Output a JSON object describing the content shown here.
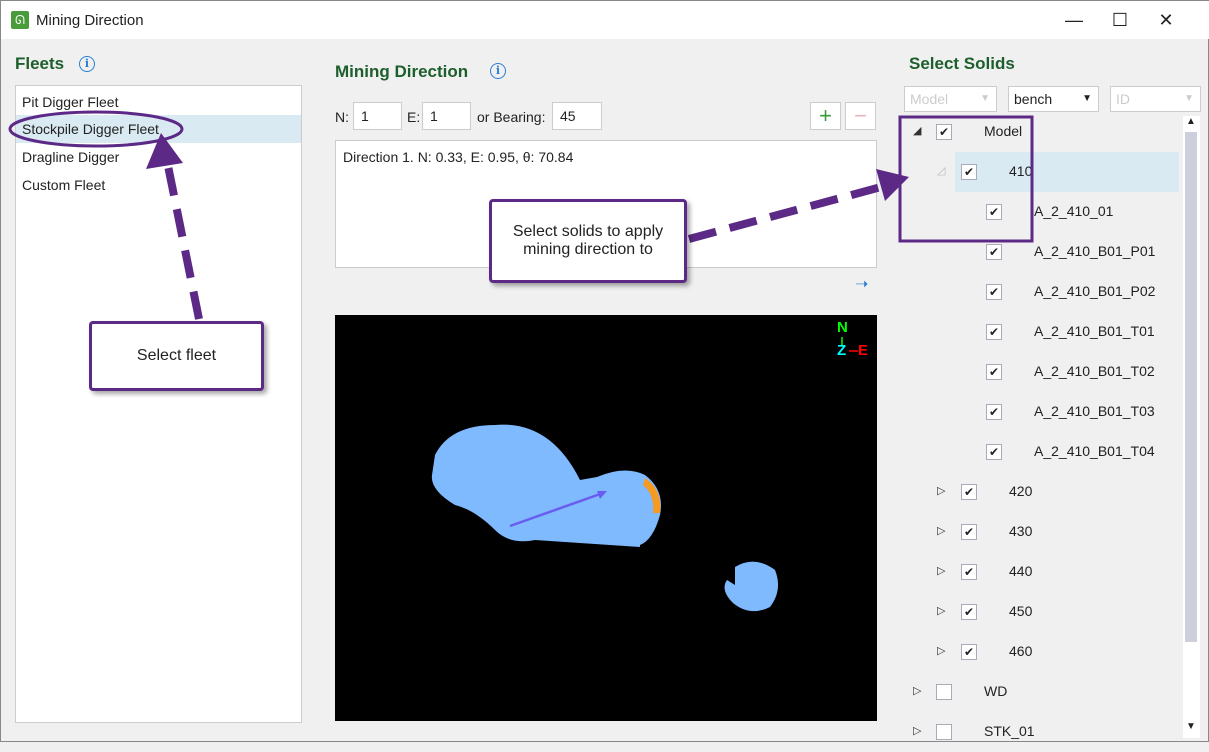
{
  "window": {
    "title": "Mining Direction",
    "minimize": "—",
    "maximize": "☐",
    "close": "✕"
  },
  "fleets": {
    "title": "Fleets",
    "items": [
      "Pit Digger Fleet",
      "Stockpile Digger Fleet",
      "Dragline Digger",
      "Custom Fleet"
    ],
    "selected": 1
  },
  "mining": {
    "title": "Mining Direction",
    "n_label": "N:",
    "n_value": "1",
    "e_label": "E:",
    "e_value": "1",
    "bearing_label": "or Bearing:",
    "bearing_value": "45",
    "add": "+",
    "remove": "−",
    "directions": [
      "Direction 1. N: 0.33, E: 0.95, θ: 70.84"
    ]
  },
  "compass": {
    "n": "N",
    "z": "Z",
    "e": "E"
  },
  "solids": {
    "title": "Select Solids",
    "combo1": "Model",
    "combo2": "bench",
    "combo3": "ID",
    "tree": [
      {
        "label": "Model",
        "level": 0,
        "toggle": "◢",
        "checked": true
      },
      {
        "label": "410",
        "level": 1,
        "toggle": "◿",
        "checked": true,
        "selected": true
      },
      {
        "label": "A_2_410_01",
        "level": 2,
        "checked": true
      },
      {
        "label": "A_2_410_B01_P01",
        "level": 2,
        "checked": true
      },
      {
        "label": "A_2_410_B01_P02",
        "level": 2,
        "checked": true
      },
      {
        "label": "A_2_410_B01_T01",
        "level": 2,
        "checked": true
      },
      {
        "label": "A_2_410_B01_T02",
        "level": 2,
        "checked": true
      },
      {
        "label": "A_2_410_B01_T03",
        "level": 2,
        "checked": true
      },
      {
        "label": "A_2_410_B01_T04",
        "level": 2,
        "checked": true
      },
      {
        "label": "420",
        "level": 1,
        "toggle": "▷",
        "checked": true
      },
      {
        "label": "430",
        "level": 1,
        "toggle": "▷",
        "checked": true
      },
      {
        "label": "440",
        "level": 1,
        "toggle": "▷",
        "checked": true
      },
      {
        "label": "450",
        "level": 1,
        "toggle": "▷",
        "checked": true
      },
      {
        "label": "460",
        "level": 1,
        "toggle": "▷",
        "checked": true
      },
      {
        "label": "WD",
        "level": 0,
        "toggle": "▷",
        "checked": false
      },
      {
        "label": "STK_01",
        "level": 0,
        "toggle": "▷",
        "checked": false
      }
    ]
  },
  "callouts": {
    "fleet": "Select fleet",
    "solids": "Select solids to apply mining direction to"
  },
  "colors": {
    "accent": "#5c2a86",
    "heading": "#1d5e2c",
    "solid": "#7fbaff",
    "highlight": "#f59a23"
  }
}
